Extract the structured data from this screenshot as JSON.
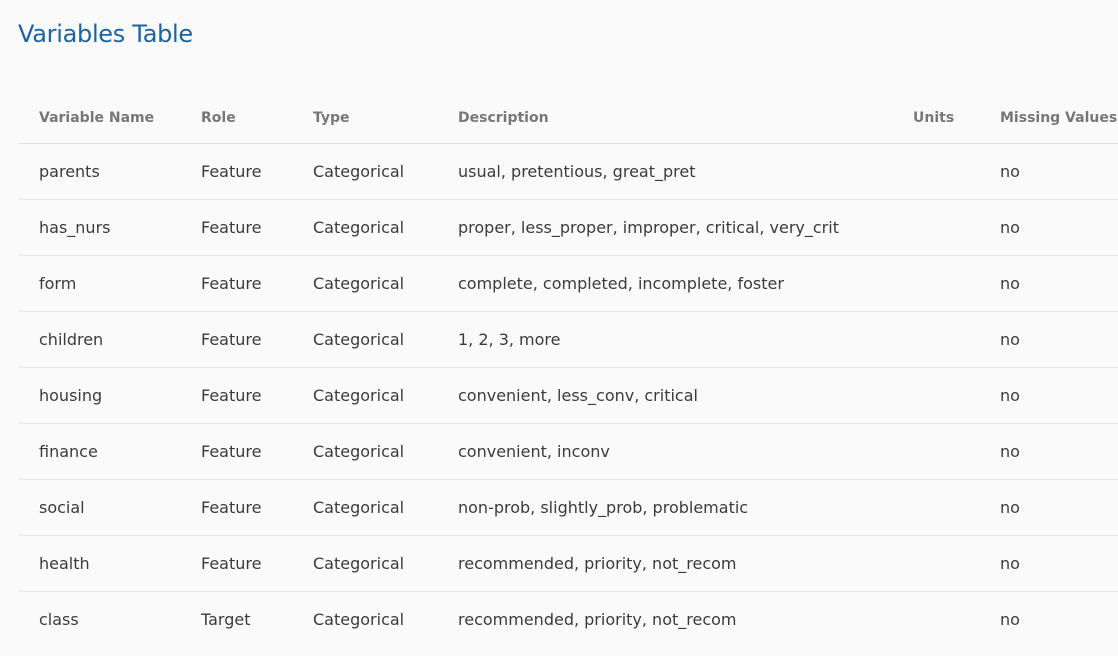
{
  "page": {
    "title": "Variables Table"
  },
  "table": {
    "headers": {
      "name": "Variable Name",
      "role": "Role",
      "type": "Type",
      "description": "Description",
      "units": "Units",
      "missing": "Missing Values"
    },
    "rows": [
      {
        "name": "parents",
        "role": "Feature",
        "type": "Categorical",
        "description": "usual, pretentious, great_pret",
        "units": "",
        "missing": "no"
      },
      {
        "name": "has_nurs",
        "role": "Feature",
        "type": "Categorical",
        "description": "proper, less_proper, improper, critical, very_crit",
        "units": "",
        "missing": "no"
      },
      {
        "name": "form",
        "role": "Feature",
        "type": "Categorical",
        "description": "complete, completed, incomplete, foster",
        "units": "",
        "missing": "no"
      },
      {
        "name": "children",
        "role": "Feature",
        "type": "Categorical",
        "description": "1, 2, 3, more",
        "units": "",
        "missing": "no"
      },
      {
        "name": "housing",
        "role": "Feature",
        "type": "Categorical",
        "description": "convenient, less_conv, critical",
        "units": "",
        "missing": "no"
      },
      {
        "name": "finance",
        "role": "Feature",
        "type": "Categorical",
        "description": "convenient, inconv",
        "units": "",
        "missing": "no"
      },
      {
        "name": "social",
        "role": "Feature",
        "type": "Categorical",
        "description": "non-prob, slightly_prob, problematic",
        "units": "",
        "missing": "no"
      },
      {
        "name": "health",
        "role": "Feature",
        "type": "Categorical",
        "description": "recommended, priority, not_recom",
        "units": "",
        "missing": "no"
      },
      {
        "name": "class",
        "role": "Target",
        "type": "Categorical",
        "description": "recommended, priority, not_recom",
        "units": "",
        "missing": "no"
      }
    ]
  },
  "colors": {
    "title": "#1b63a3",
    "header_text": "#777777",
    "cell_text": "#3b3b3b",
    "background": "#fafafa"
  }
}
